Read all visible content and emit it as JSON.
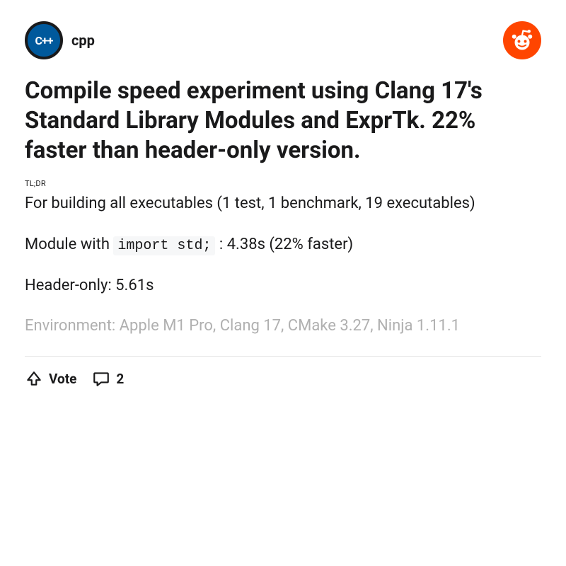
{
  "header": {
    "subreddit": "cpp",
    "subredditIconText": "C++"
  },
  "post": {
    "title": "Compile speed experiment using Clang 17's Standard Library Modules and ExprTk. 22% faster than header-only version.",
    "tldr": "TL;DR",
    "body": {
      "line1": "For building all executables (1 test, 1 benchmark, 19 executables)",
      "line2_prefix": "Module with ",
      "line2_code": "import std;",
      "line2_suffix": " : 4.38s (22% faster)",
      "line3": "Header-only: 5.61s",
      "line4": "Environment: Apple M1 Pro, Clang 17, CMake 3.27, Ninja 1.11.1"
    }
  },
  "actions": {
    "vote": "Vote",
    "comments": "2"
  }
}
